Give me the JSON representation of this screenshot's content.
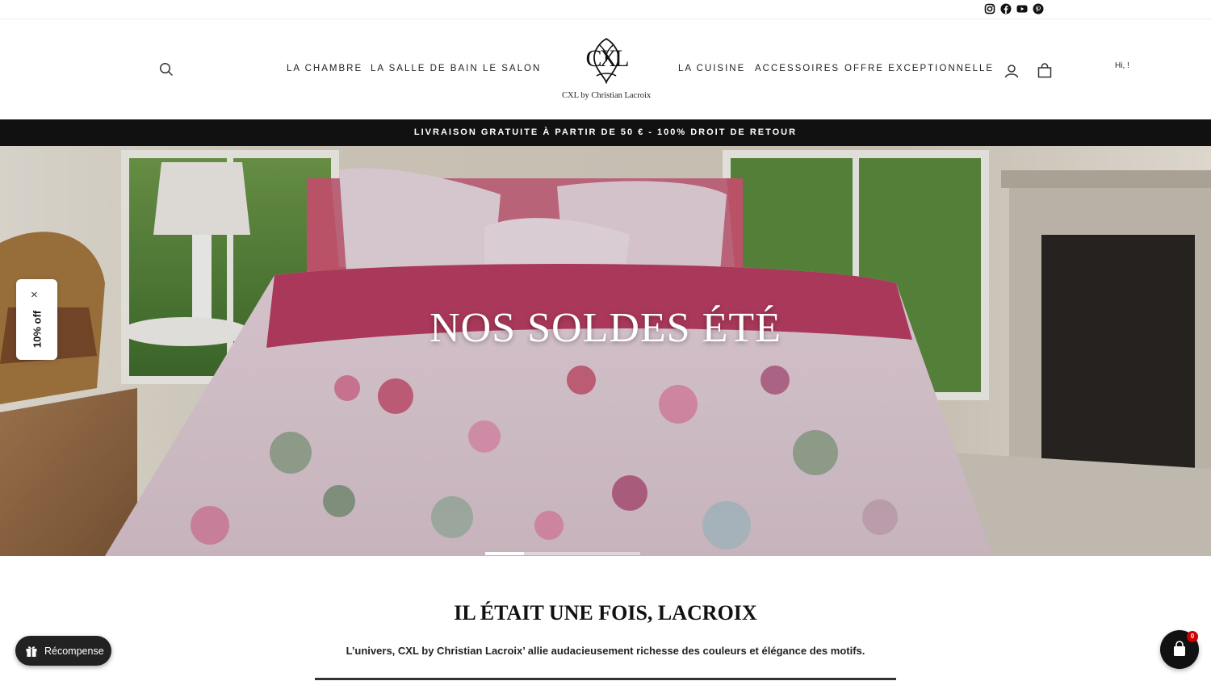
{
  "social": {
    "icons": [
      "instagram-icon",
      "facebook-icon",
      "youtube-icon",
      "pinterest-icon"
    ]
  },
  "nav": {
    "left": [
      "LA CHAMBRE",
      "LA SALLE DE BAIN",
      "LE SALON"
    ],
    "right": [
      "LA CUISINE",
      "ACCESSOIRES",
      "OFFRE EXCEPTIONNELLE"
    ]
  },
  "logo": {
    "monogram": "CXL",
    "text": "CXL by Christian Lacroix"
  },
  "greeting": "Hi, !",
  "announcement": "LIVRAISON GRATUITE À PARTIR DE 50 € - 100% DROIT DE RETOUR",
  "hero": {
    "title": "NOS SOLDES ÉTÉ",
    "slides": 4,
    "active_slide": 1
  },
  "promo": {
    "close": "×",
    "label": "10% off"
  },
  "section": {
    "title": "IL ÉTAIT UNE FOIS, LACROIX",
    "intro": "L’univers, CXL by Christian Lacroix’ allie audacieusement richesse des couleurs et élégance des motifs."
  },
  "rewards": {
    "label": "Récompense"
  },
  "cart": {
    "count": "0"
  },
  "colors": {
    "announcement_bg": "#111111",
    "badge": "#cc0000"
  }
}
